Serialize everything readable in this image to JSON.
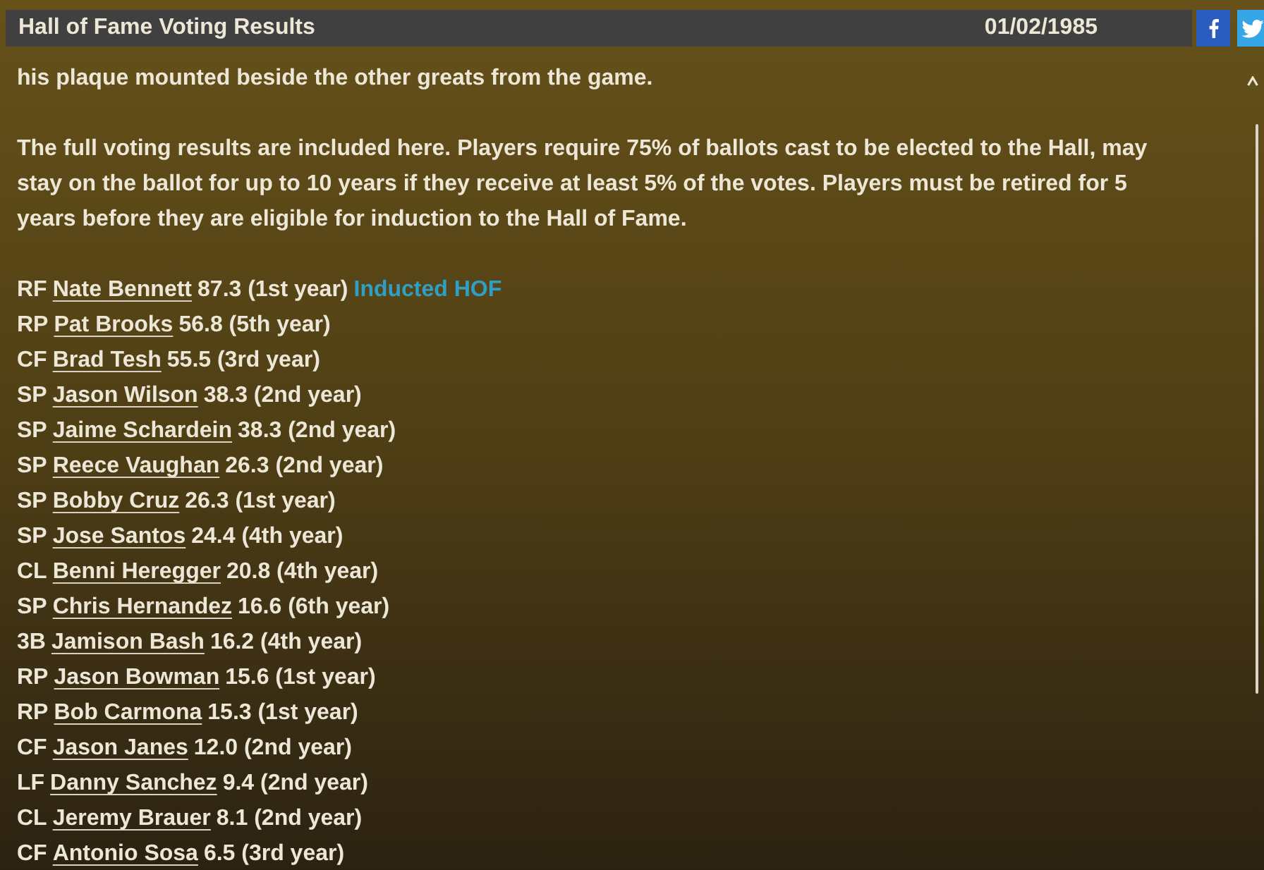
{
  "header": {
    "title": "Hall of Fame Voting Results",
    "date": "01/02/1985"
  },
  "article": {
    "paragraphs": [
      "his plaque mounted beside the other greats from the game.",
      "The full voting results are included here. Players require 75% of ballots cast to be elected to the Hall, may stay on the ballot for up to 10 years if they receive at least 5% of the votes. Players must be retired for 5 years before they are eligible for induction to the Hall of Fame."
    ],
    "results": [
      {
        "position": "RF",
        "name": "Nate Bennett",
        "result": "87.3 (1st year)",
        "note": "Inducted HOF"
      },
      {
        "position": "RP",
        "name": "Pat Brooks",
        "result": "56.8 (5th year)"
      },
      {
        "position": "CF",
        "name": "Brad Tesh",
        "result": "55.5 (3rd year)"
      },
      {
        "position": "SP",
        "name": "Jason Wilson",
        "result": "38.3 (2nd year)"
      },
      {
        "position": "SP",
        "name": "Jaime Schardein",
        "result": "38.3 (2nd year)"
      },
      {
        "position": "SP",
        "name": "Reece Vaughan",
        "result": "26.3 (2nd year)"
      },
      {
        "position": "SP",
        "name": "Bobby Cruz",
        "result": "26.3 (1st year)"
      },
      {
        "position": "SP",
        "name": "Jose Santos",
        "result": "24.4 (4th year)"
      },
      {
        "position": "CL",
        "name": "Benni Heregger",
        "result": "20.8 (4th year)"
      },
      {
        "position": "SP",
        "name": "Chris Hernandez",
        "result": "16.6 (6th year)"
      },
      {
        "position": "3B",
        "name": "Jamison Bash",
        "result": "16.2 (4th year)"
      },
      {
        "position": "RP",
        "name": "Jason Bowman",
        "result": "15.6 (1st year)"
      },
      {
        "position": "RP",
        "name": "Bob Carmona",
        "result": "15.3 (1st year)"
      },
      {
        "position": "CF",
        "name": "Jason Janes",
        "result": "12.0 (2nd year)"
      },
      {
        "position": "LF",
        "name": "Danny Sanchez",
        "result": "9.4 (2nd year)"
      },
      {
        "position": "CL",
        "name": "Jeremy Brauer",
        "result": "8.1 (2nd year)"
      },
      {
        "position": "CF",
        "name": "Antonio Sosa",
        "result": "6.5 (3rd year)"
      }
    ]
  }
}
